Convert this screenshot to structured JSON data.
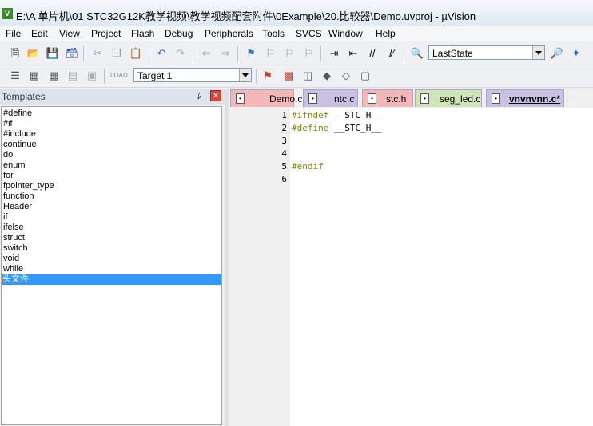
{
  "window": {
    "title": "E:\\A 单片机\\01 STC32G12K教学视频\\教学视频配套附件\\0Example\\20.比较器\\Demo.uvproj - µVision"
  },
  "menu": [
    "File",
    "Edit",
    "View",
    "Project",
    "Flash",
    "Debug",
    "Peripherals",
    "Tools",
    "SVCS",
    "Window",
    "Help"
  ],
  "toolbar": {
    "layout_combo": "LastState",
    "target_combo": "Target 1"
  },
  "templates": {
    "title": "Templates",
    "items": [
      "#define",
      "#if",
      "#include",
      "continue",
      "do",
      "enum",
      "for",
      "fpointer_type",
      "function",
      "Header",
      "if",
      "ifelse",
      "struct",
      "switch",
      "void",
      "while",
      "头文件"
    ]
  },
  "tabs": [
    {
      "label": "Demo.c",
      "color": "#f4b8b8"
    },
    {
      "label": "ntc.c",
      "color": "#c9c1e4"
    },
    {
      "label": "stc.h",
      "color": "#f4b8b8"
    },
    {
      "label": "seg_led.c",
      "color": "#cfe4b8"
    },
    {
      "label": "vnvnvnn.c*",
      "color": "#c9c1e4"
    }
  ],
  "editor": {
    "lines": [
      {
        "num": "1",
        "kw": "#ifndef",
        "rest": " __STC_H__"
      },
      {
        "num": "2",
        "kw": "#define",
        "rest": " __STC_H__"
      },
      {
        "num": "3",
        "kw": "",
        "rest": ""
      },
      {
        "num": "4",
        "kw": "",
        "rest": ""
      },
      {
        "num": "5",
        "kw": "#endif",
        "rest": ""
      },
      {
        "num": "6",
        "kw": "",
        "rest": ""
      }
    ]
  }
}
